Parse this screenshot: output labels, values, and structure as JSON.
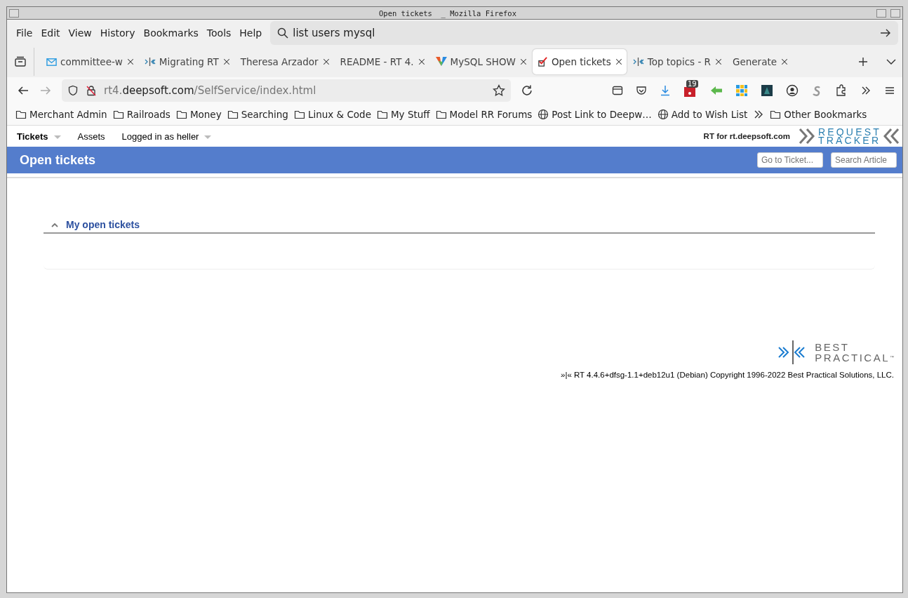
{
  "window": {
    "title": "Open tickets  _ Mozilla Firefox"
  },
  "menu": [
    "File",
    "Edit",
    "View",
    "History",
    "Bookmarks",
    "Tools",
    "Help"
  ],
  "search": {
    "value": "list users mysql"
  },
  "tabs": [
    {
      "label": "committee-w",
      "kind": "mail",
      "selected": false
    },
    {
      "label": "Migrating RT",
      "kind": "rt",
      "selected": false
    },
    {
      "label": "Theresa Arzador",
      "kind": "plain",
      "selected": false
    },
    {
      "label": "README - RT 4.",
      "kind": "plain",
      "selected": false
    },
    {
      "label": "MySQL SHOW",
      "kind": "mysql",
      "selected": false
    },
    {
      "label": "Open tickets",
      "kind": "check",
      "selected": true
    },
    {
      "label": "Top topics - R",
      "kind": "rt",
      "selected": false
    },
    {
      "label": "Generate",
      "kind": "plain",
      "selected": false
    }
  ],
  "url": {
    "prefix": "rt4.",
    "domain": "deepsoft.com",
    "path": "/SelfService/index.html"
  },
  "toolbar": {
    "badge": "19"
  },
  "bookmarks": [
    {
      "label": "Merchant Admin",
      "kind": "folder"
    },
    {
      "label": "Railroads",
      "kind": "folder"
    },
    {
      "label": "Money",
      "kind": "folder"
    },
    {
      "label": "Searching",
      "kind": "folder"
    },
    {
      "label": "Linux & Code",
      "kind": "folder"
    },
    {
      "label": "My Stuff",
      "kind": "folder"
    },
    {
      "label": "Model RR Forums",
      "kind": "folder"
    },
    {
      "label": "Post Link to Deepw…",
      "kind": "globe"
    },
    {
      "label": "Add to Wish List",
      "kind": "globe"
    },
    {
      "kind": "overflow"
    },
    {
      "label": "Other Bookmarks",
      "kind": "folder"
    }
  ],
  "rt_nav": {
    "items": [
      {
        "label": "Tickets",
        "selected": true,
        "dropdown": true
      },
      {
        "label": "Assets",
        "selected": false,
        "dropdown": false
      },
      {
        "label": "Logged in as heller",
        "selected": false,
        "dropdown": true
      }
    ],
    "site": "RT for rt.deepsoft.com",
    "logo": [
      "REQUEST",
      "TRACKER"
    ]
  },
  "header": {
    "title": "Open tickets",
    "fields": [
      {
        "placeholder": "Go to Ticket..."
      },
      {
        "placeholder": "Search Article"
      }
    ]
  },
  "section": {
    "title": "My open tickets",
    "expanded": true
  },
  "footer": {
    "logo": [
      "BEST",
      "PRACTICAL"
    ],
    "trademark": "™",
    "copyright": "»|« RT 4.4.6+dfsg-1.1+deb12u1 (Debian) Copyright 1996-2022 Best Practical Solutions, LLC."
  }
}
